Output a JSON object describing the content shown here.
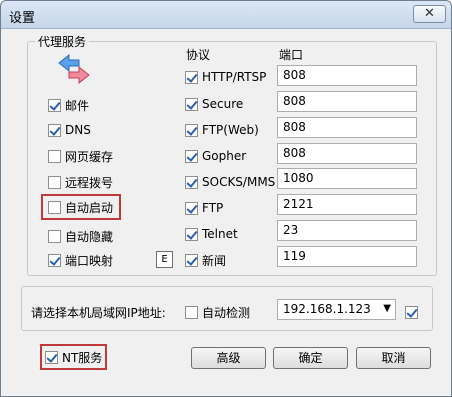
{
  "window": {
    "title": "设置",
    "close_label": "✕"
  },
  "proxy": {
    "group_title": "代理服务",
    "col_protocol": "协议",
    "col_port": "端口",
    "left_options": [
      {
        "label": "邮件",
        "checked": true
      },
      {
        "label": "DNS",
        "checked": true
      },
      {
        "label": "网页缓存",
        "checked": false
      },
      {
        "label": "远程拨号",
        "checked": false
      },
      {
        "label": "自动启动",
        "checked": false
      },
      {
        "label": "自动隐藏",
        "checked": false
      },
      {
        "label": "端口映射",
        "checked": true
      }
    ],
    "e_button_label": "E",
    "protocols": [
      {
        "label": "HTTP/RTSP",
        "checked": true,
        "port": "808"
      },
      {
        "label": "Secure",
        "checked": true,
        "port": "808"
      },
      {
        "label": "FTP(Web)",
        "checked": true,
        "port": "808"
      },
      {
        "label": "Gopher",
        "checked": true,
        "port": "808"
      },
      {
        "label": "SOCKS/MMS",
        "checked": true,
        "port": "1080"
      },
      {
        "label": "FTP",
        "checked": true,
        "port": "2121"
      },
      {
        "label": "Telnet",
        "checked": true,
        "port": "23"
      },
      {
        "label": "新闻",
        "checked": true,
        "port": "119"
      }
    ]
  },
  "lan": {
    "label": "请选择本机局域网IP地址:",
    "auto_detect_label": "自动检测",
    "auto_detect_checked": false,
    "ip_value": "192.168.1.123",
    "extra_checked": true
  },
  "footer": {
    "nt_service_label": "NT服务",
    "nt_service_checked": true,
    "advanced_label": "高级",
    "ok_label": "确定",
    "cancel_label": "取消"
  },
  "colors": {
    "highlight": "#c0393b",
    "checkmark": "#2a5fb0"
  }
}
